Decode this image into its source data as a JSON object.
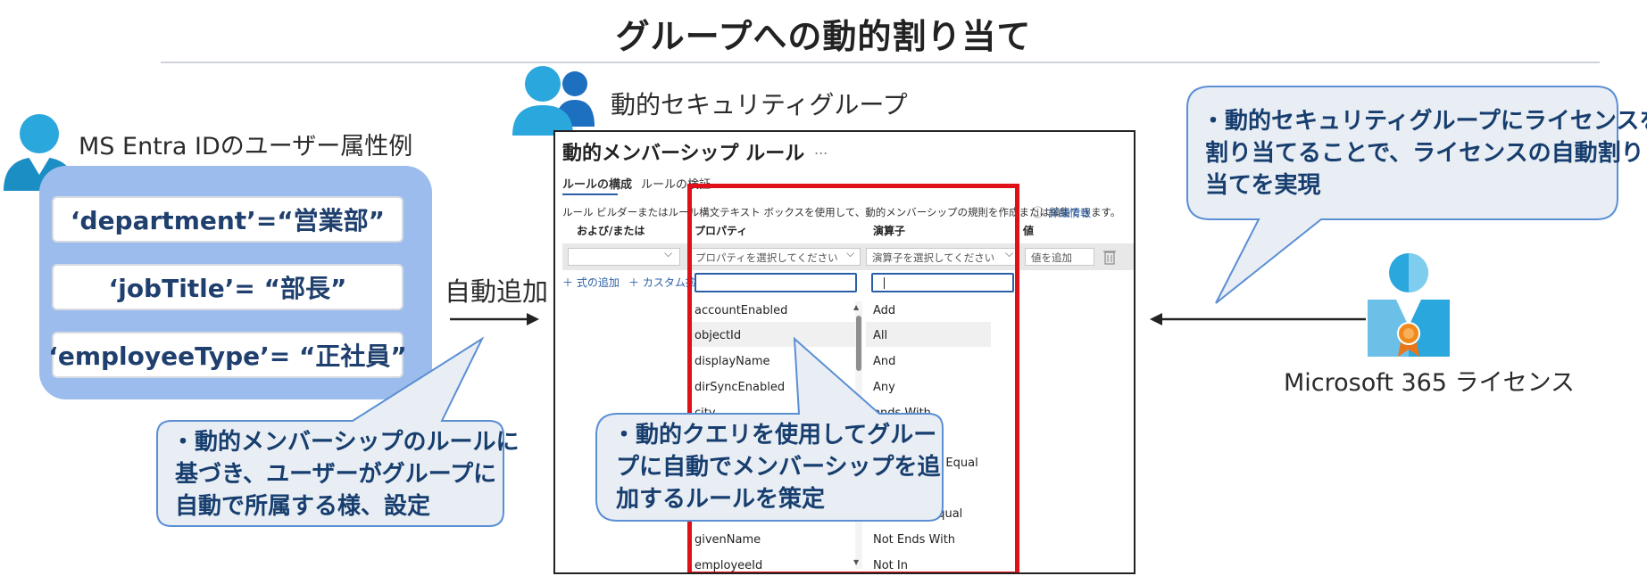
{
  "title": "グループへの動的割り当て",
  "left": {
    "heading": "MS Entra IDのユーザー属性例",
    "attributes": [
      "‘department’=“営業部”",
      "‘jobTitle’= “部長”",
      "‘employeeType’= “正社員”"
    ],
    "auto_add_label": "自動追加",
    "callout_lines": [
      "・動的メンバーシップのルールに",
      "基づき、ユーザーがグループに",
      "自動で所属する様、設定"
    ]
  },
  "group": {
    "heading": "動的セキュリティグループ"
  },
  "rule_builder": {
    "title": "動的メンバーシップ ルール",
    "ellipsis": "...",
    "tabs": [
      "ルールの構成",
      "ルールの検証"
    ],
    "description": "ルール ビルダーまたはルール構文テキスト ボックスを使用して、動的メンバーシップの規則を作成または編集できます。",
    "detail_icon": "ⓘ",
    "detail_link": "詳細情報",
    "columns": [
      "および/または",
      "プロパティ",
      "演算子",
      "値"
    ],
    "property_placeholder": "プロパティを選択してください",
    "operator_placeholder": "演算子を選択してください",
    "value_placeholder": "値を追加",
    "add_expression": "＋ 式の追加",
    "add_custom": "＋ カスタム拡",
    "properties": [
      "accountEnabled",
      "objectId",
      "displayName",
      "dirSyncEnabled",
      "city",
      "givenName",
      "employeeId"
    ],
    "operators": [
      "Add",
      "All",
      "And",
      "Any",
      "ends With",
      "or Equal",
      "Equal",
      "Not Ends With",
      "Not In"
    ],
    "callout_lines": [
      "・動的クエリを使用してグルー",
      "プに自動でメンバーシップを追",
      "加するルールを策定"
    ]
  },
  "right": {
    "callout_lines": [
      "・動的セキュリティグループにライセンスを",
      "割り当てることで、ライセンスの自動割り",
      "当てを実現"
    ],
    "license_label": "Microsoft 365 ライセンス"
  },
  "colors": {
    "panel_blue": "#9dbcee",
    "callout_fill": "#e9eef5",
    "callout_border": "#5b8fd4",
    "text_navy": "#173e6e",
    "red_frame": "#e0101a",
    "icon_blue": "#2aa7dd"
  }
}
